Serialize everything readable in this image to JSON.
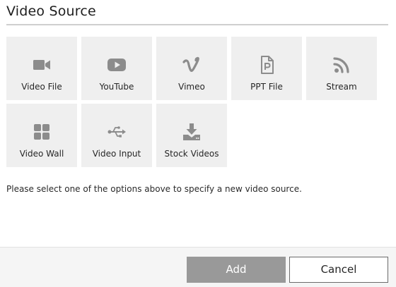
{
  "dialog": {
    "title": "Video Source",
    "message": "Please select one of the options above to specify a new video source."
  },
  "options": [
    {
      "label": "Video File",
      "icon": "video-camera-icon"
    },
    {
      "label": "YouTube",
      "icon": "youtube-icon"
    },
    {
      "label": "Vimeo",
      "icon": "vimeo-icon"
    },
    {
      "label": "PPT File",
      "icon": "ppt-file-icon"
    },
    {
      "label": "Stream",
      "icon": "rss-stream-icon"
    },
    {
      "label": "Video Wall",
      "icon": "grid-icon"
    },
    {
      "label": "Video Input",
      "icon": "usb-icon"
    },
    {
      "label": "Stock Videos",
      "icon": "download-icon"
    }
  ],
  "footer": {
    "add_label": "Add",
    "cancel_label": "Cancel"
  },
  "colors": {
    "tile_background": "#efefef",
    "icon_color": "#8c8c8c",
    "add_button_background": "#999999"
  }
}
